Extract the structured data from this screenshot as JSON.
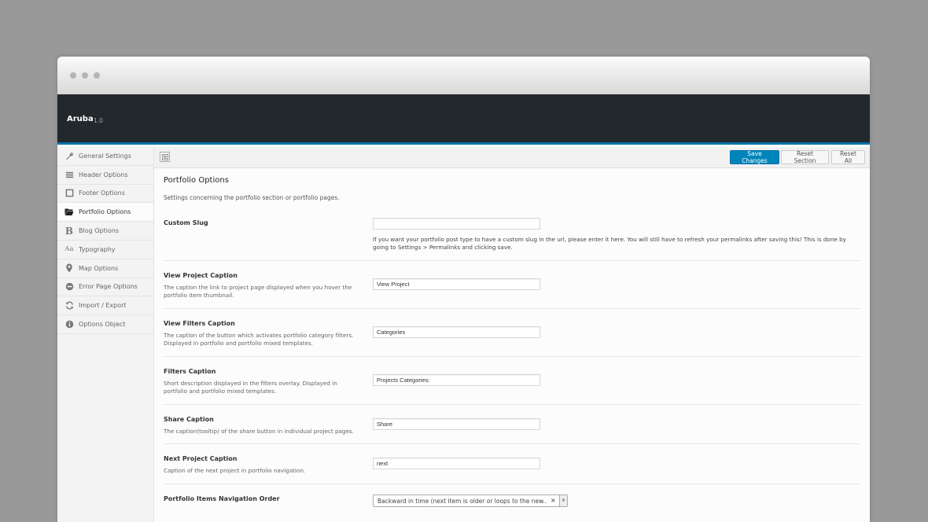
{
  "app": {
    "title": "Aruba",
    "version": "1.0"
  },
  "sidebar": {
    "items": [
      {
        "label": "General Settings",
        "icon": "wrench-icon",
        "active": false
      },
      {
        "label": "Header Options",
        "icon": "bars-icon",
        "active": false
      },
      {
        "label": "Footer Options",
        "icon": "square-icon",
        "active": false
      },
      {
        "label": "Portfolio Options",
        "icon": "folder-open-icon",
        "active": true
      },
      {
        "label": "Blog Options",
        "icon": "bold-b-icon",
        "active": false
      },
      {
        "label": "Typography",
        "icon": "typography-aa-icon",
        "active": false
      },
      {
        "label": "Map Options",
        "icon": "map-marker-icon",
        "active": false
      },
      {
        "label": "Error Page Options",
        "icon": "minus-circle-icon",
        "active": false
      },
      {
        "label": "Import / Export",
        "icon": "refresh-icon",
        "active": false
      },
      {
        "label": "Options Object",
        "icon": "info-circle-icon",
        "active": false
      }
    ]
  },
  "toolbar": {
    "save_label": "Save Changes",
    "reset_section_label": "Reset Section",
    "reset_all_label": "Reset All"
  },
  "section": {
    "title": "Portfolio Options",
    "description": "Settings concerning the portfolio section or portfolio pages."
  },
  "options": {
    "custom_slug": {
      "label": "Custom Slug",
      "value": "",
      "help": "If you want your portfolio post type to have a custom slug in the url, please enter it here. You will still have to refresh your permalinks after saving this! This is done by going to Settings > Permalinks and clicking save."
    },
    "view_project": {
      "label": "View Project Caption",
      "description": "The caption the link to project page displayed when you hover the portfolio item thumbnail.",
      "value": "View Project"
    },
    "view_filters": {
      "label": "View Filters Caption",
      "description": "The caption of the button which activates portfolio category filters. Displayed in portfolio and portfolio mixed templates.",
      "value": "Categories"
    },
    "filters_caption": {
      "label": "Filters Caption",
      "description": "Short description displayed in the filters overlay. Displayed in portfolio and portfolio mixed templates.",
      "value": "Projects Categories:"
    },
    "share_caption": {
      "label": "Share Caption",
      "description": "The caption(tooltip) of the share button in individual project pages.",
      "value": "Share"
    },
    "next_project": {
      "label": "Next Project Caption",
      "description": "Caption of the next project in portfolio navigation.",
      "value": "next"
    },
    "nav_order": {
      "label": "Portfolio Items Navigation Order",
      "selected": "Backward in time (next item is older or loops to the new..."
    }
  },
  "colors": {
    "background": "#999999",
    "appbar": "#23282d",
    "accent": "#0073aa",
    "primary_button": "#0085ba"
  }
}
